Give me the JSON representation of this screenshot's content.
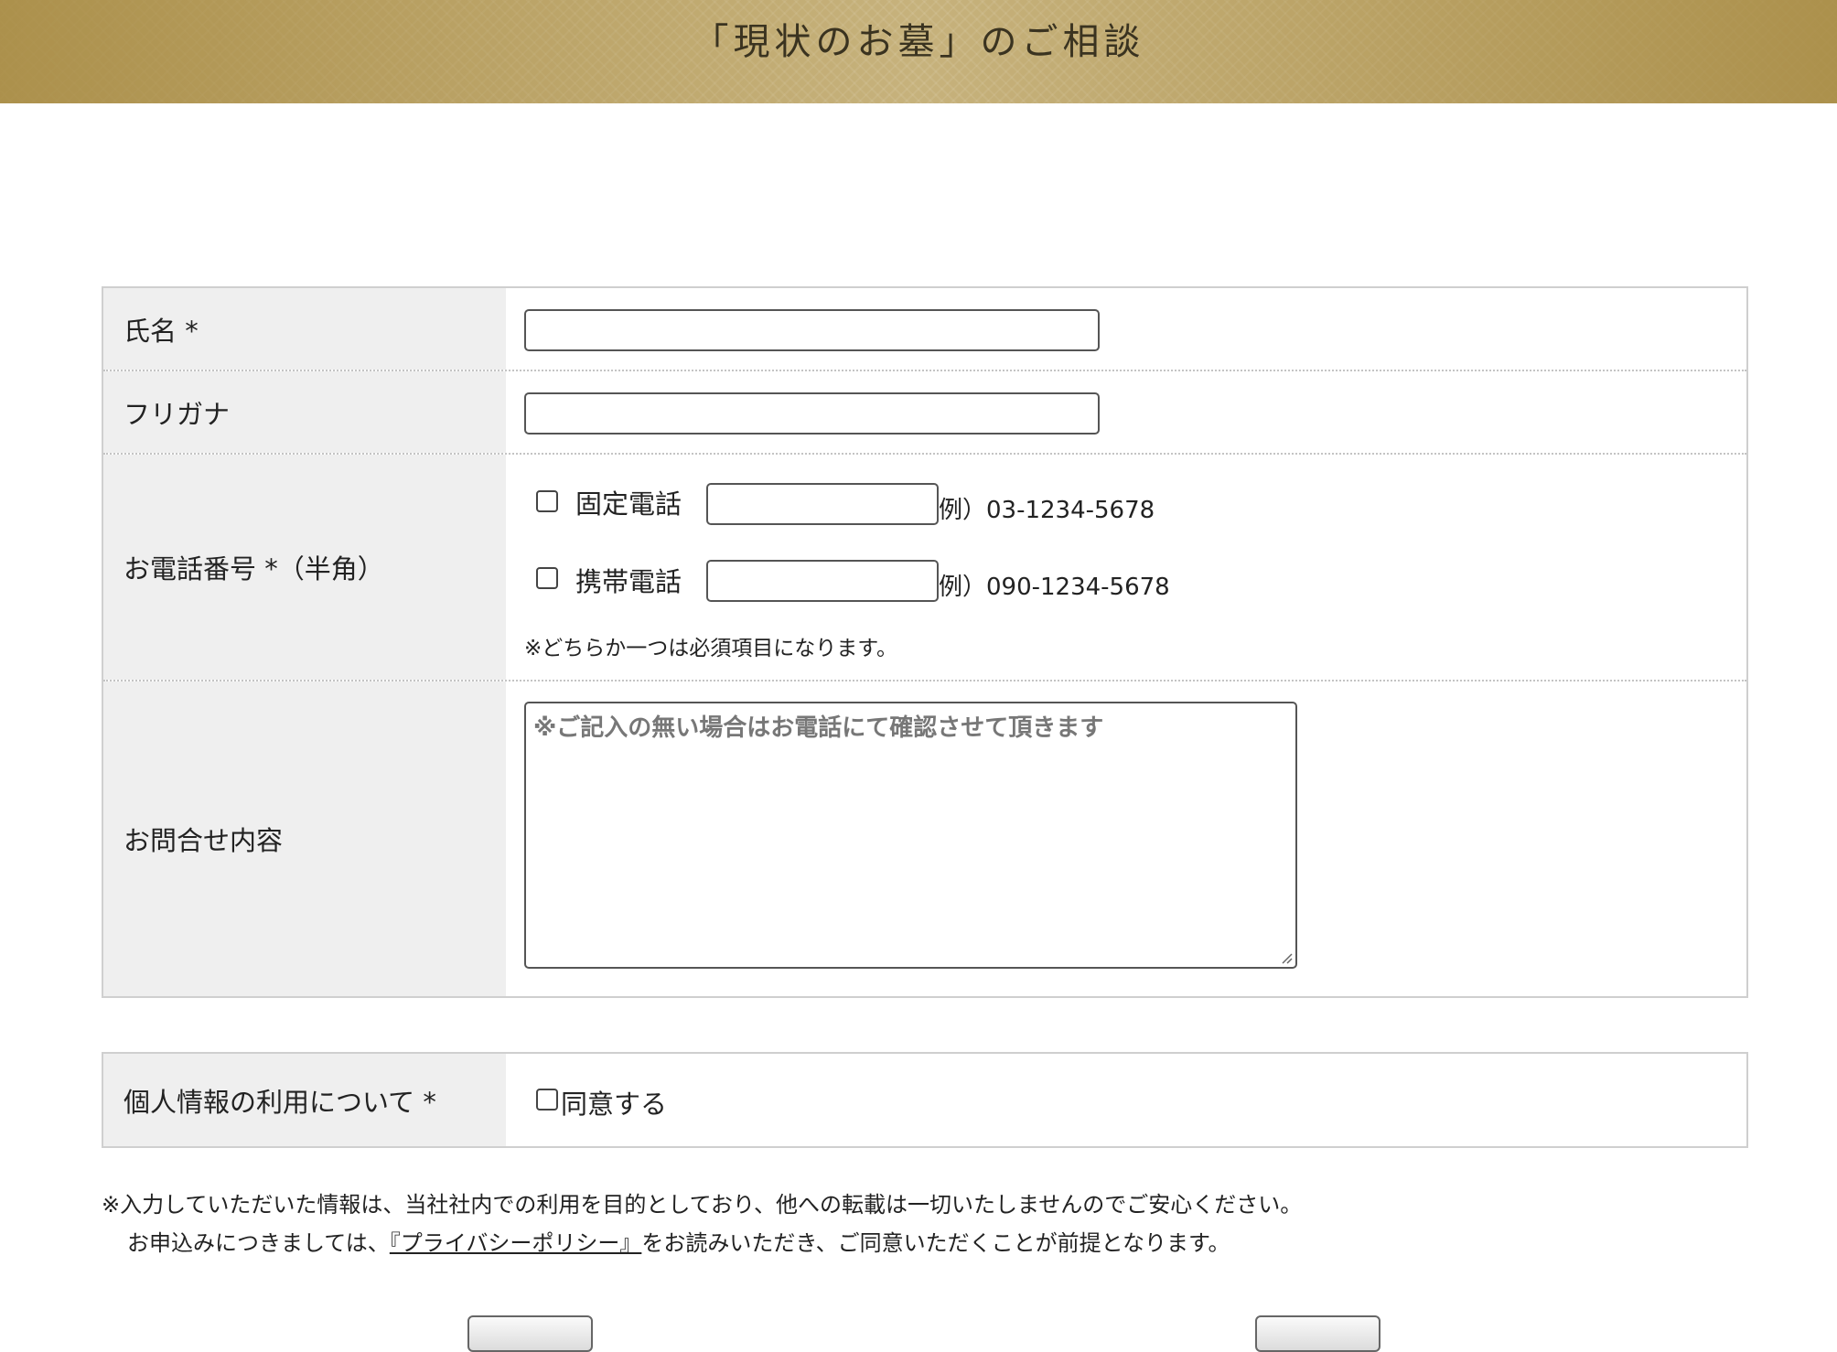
{
  "header": {
    "title": "「現状のお墓」のご相談"
  },
  "form": {
    "name_label": "氏名 *",
    "furigana_label": "フリガナ",
    "phone_label": "お電話番号 *（半角）",
    "landline_label": "固定電話",
    "landline_example": "例）03-1234-5678",
    "mobile_label": "携帯電話",
    "mobile_example": "例）090-1234-5678",
    "phone_note": "※どちらか一つは必須項目になります。",
    "inquiry_label": "お問合せ内容",
    "inquiry_placeholder": "※ご記入の無い場合はお電話にて確認させて頂きます"
  },
  "consent": {
    "label": "個人情報の利用について *",
    "agree_label": "同意する"
  },
  "privacy_notice": {
    "line1": "※入力していただいた情報は、当社社内での利用を目的としており、他への転載は一切いたしませんのでご安心ください。",
    "line2_before": "お申込みにつきましては、",
    "link_text": "『プライバシーポリシー』",
    "line2_after": "をお読みいただき、ご同意いただくことが前提となります。"
  }
}
